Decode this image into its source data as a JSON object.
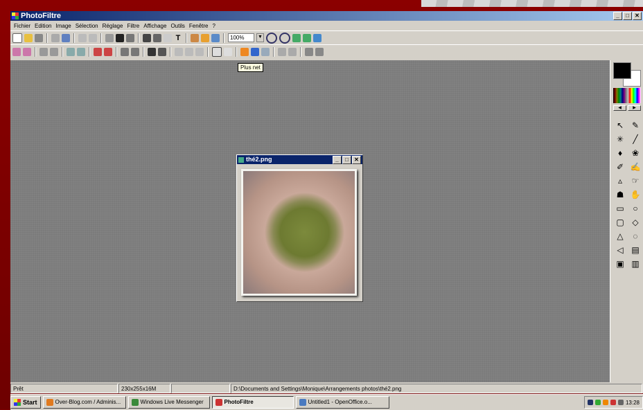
{
  "app": {
    "title": "PhotoFiltre",
    "window_buttons": [
      "_",
      "×",
      "×"
    ]
  },
  "menu": [
    "Fichier",
    "Edition",
    "Image",
    "Sélection",
    "Réglage",
    "Filtre",
    "Affichage",
    "Outils",
    "Fenêtre",
    "?"
  ],
  "toolbar": {
    "zoom_value": "100%"
  },
  "tooltip": "Plus net",
  "image_window": {
    "title": "thé2.png"
  },
  "status": {
    "ready": "Prêt",
    "size": "230x255x16M",
    "blank": "",
    "path": "D:\\Documents and Settings\\Monique\\Arrangements photos\\thé2.png"
  },
  "taskbar": {
    "start": "Start",
    "tasks": [
      {
        "label": "Over-Blog.com / Adminis...",
        "color": "#e07a1f"
      },
      {
        "label": "Windows Live Messenger",
        "color": "#3a8a3a"
      },
      {
        "label": "PhotoFiltre",
        "color": "#c33"
      },
      {
        "label": "Untitled1 - OpenOffice.o...",
        "color": "#4a7ac0"
      }
    ],
    "clock": "13:28"
  }
}
